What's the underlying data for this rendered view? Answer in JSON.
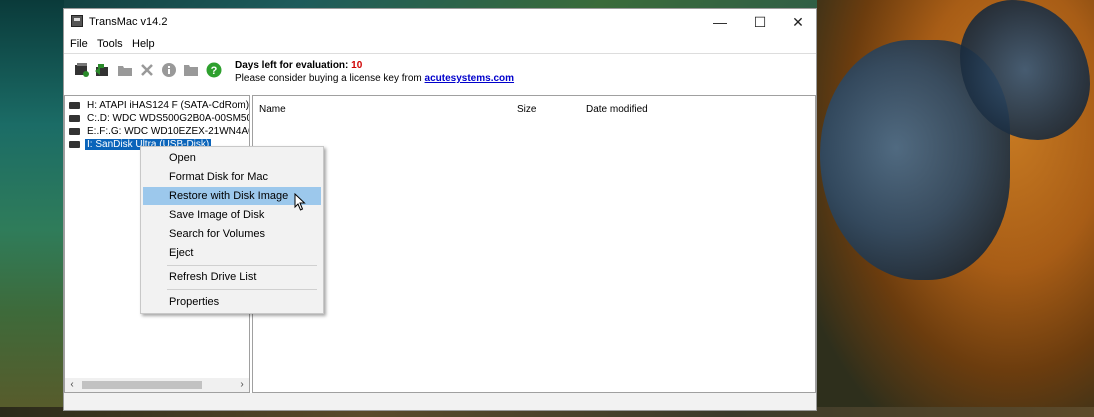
{
  "window": {
    "title": "TransMac v14.2",
    "controls": {
      "minimize": "—",
      "maximize": "☐",
      "close": "✕"
    }
  },
  "menu": [
    "File",
    "Tools",
    "Help"
  ],
  "toolbar": {
    "icons": [
      "scan-icon",
      "install-icon",
      "folder-icon",
      "delete-icon",
      "info-icon",
      "open-folder-icon",
      "help-icon"
    ],
    "eval_label": "Days left for evaluation:",
    "eval_days": "10",
    "license_text": "Please consider buying a license key from",
    "license_link": "acutesystems.com"
  },
  "drives": [
    {
      "label": "H:  ATAPI iHAS124   F (SATA-CdRom)",
      "selected": false
    },
    {
      "label": "C:.D:  WDC  WDS500G2B0A-00SM50 (",
      "selected": false
    },
    {
      "label": "E:.F:.G:  WDC WD10EZEX-21WN4A0 (",
      "selected": false
    },
    {
      "label": "I: SanDisk Ultra (USB-Disk)",
      "selected": true
    }
  ],
  "file_columns": [
    "Name",
    "Size",
    "Date modified"
  ],
  "scrollbar": {
    "left": "‹",
    "right": "›"
  },
  "context_menu": {
    "items": [
      "Open",
      "Format Disk for Mac",
      "Restore with Disk Image",
      "Save Image of Disk",
      "Search for Volumes",
      "Eject",
      "Refresh Drive List",
      "Properties"
    ],
    "highlighted": "Restore with Disk Image"
  }
}
